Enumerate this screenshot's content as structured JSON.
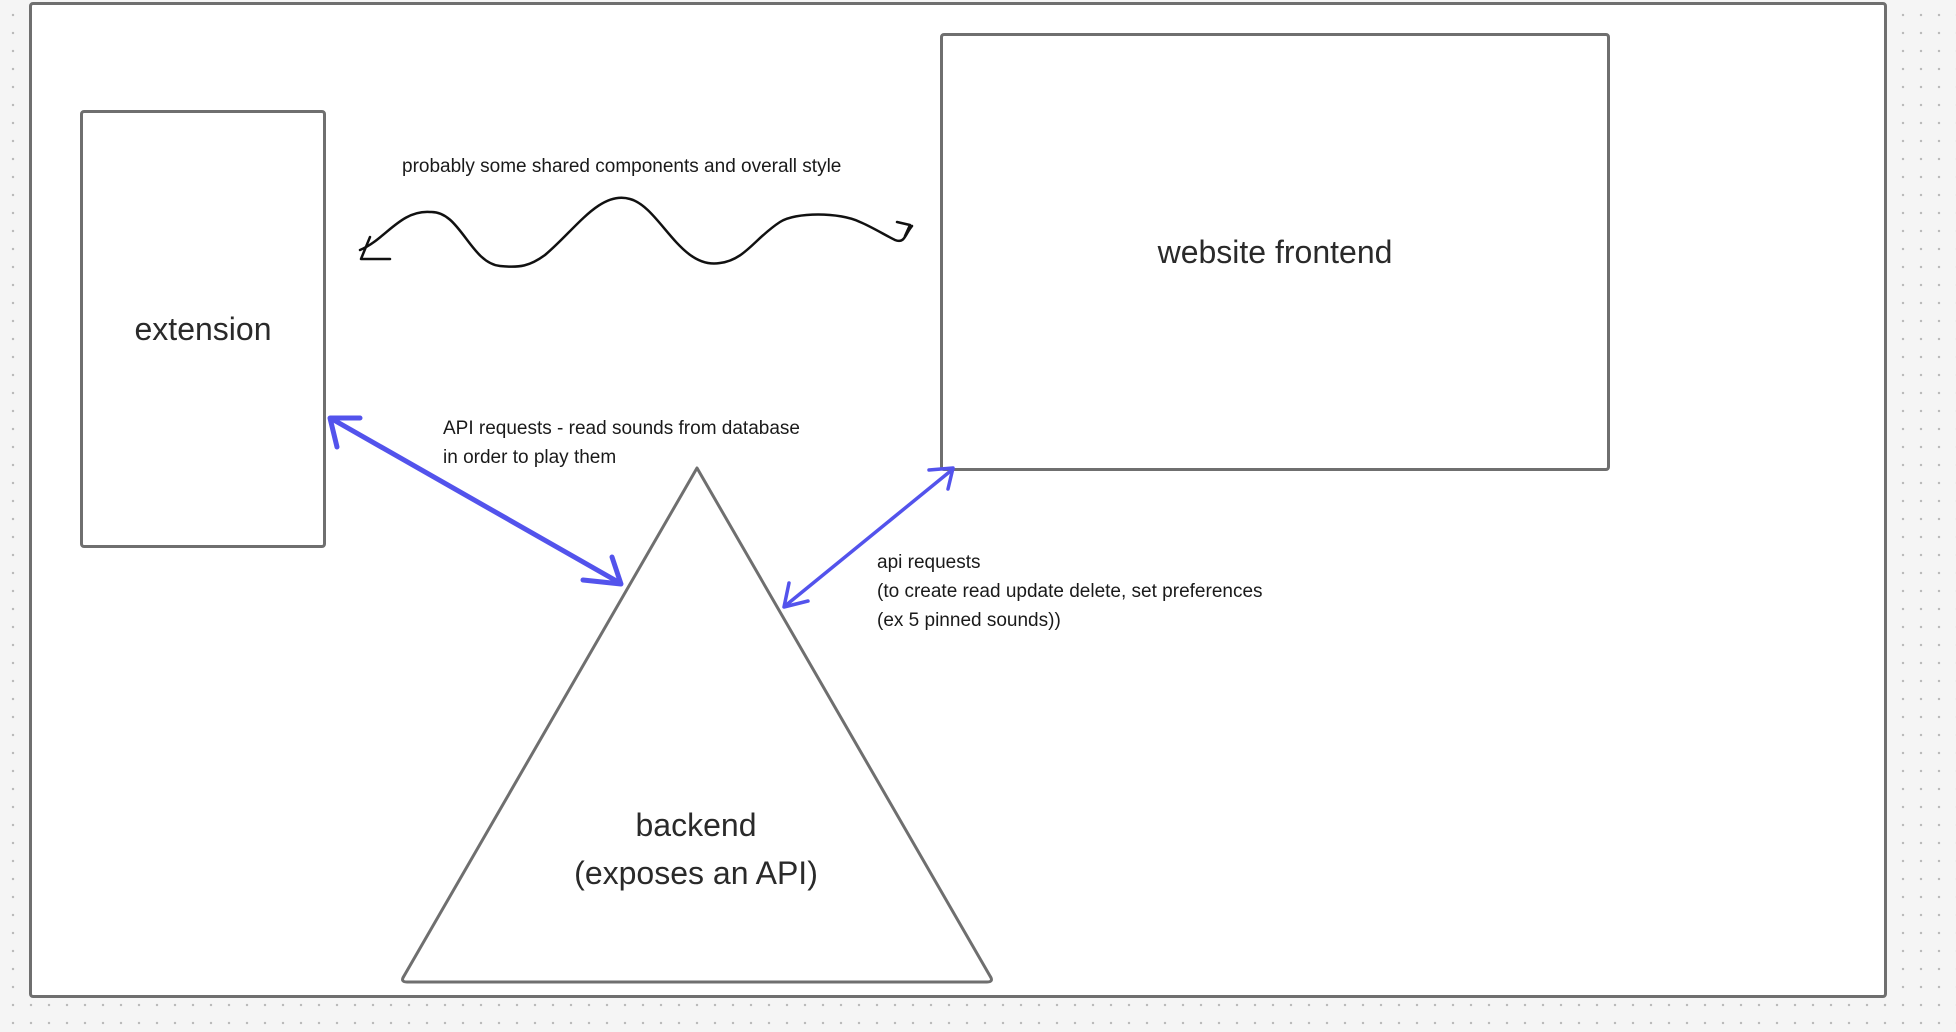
{
  "nodes": {
    "extension": {
      "label": "extension"
    },
    "website_frontend": {
      "label": "website frontend"
    },
    "backend": {
      "line1": "backend",
      "line2": "(exposes an API)"
    }
  },
  "edges": {
    "shared": {
      "label": "probably some shared components and overall style",
      "style": "squiggle",
      "color": "#111111"
    },
    "extension_backend": {
      "label_line1": "API requests - read sounds from database",
      "label_line2": "in order to play them",
      "style": "double-arrow",
      "color": "#5353ec"
    },
    "frontend_backend": {
      "label_line1": "api requests",
      "label_line2": "(to create read update delete, set preferences",
      "label_line3": "(ex 5 pinned sounds))",
      "style": "double-arrow",
      "color": "#5353ec"
    }
  },
  "colors": {
    "canvas": "#f5f5f5",
    "frame_border": "#6f6f6f",
    "arrow": "#5353ec"
  }
}
